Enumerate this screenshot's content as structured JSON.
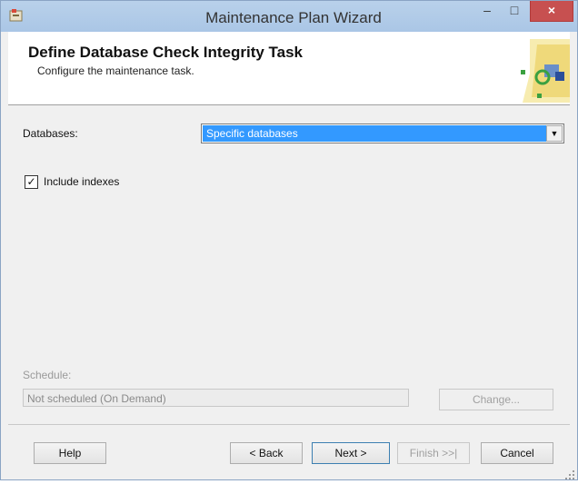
{
  "window": {
    "title": "Maintenance Plan Wizard",
    "minimize": "–",
    "maximize": "□",
    "close": "×"
  },
  "header": {
    "title": "Define Database Check Integrity Task",
    "subtitle": "Configure the maintenance task."
  },
  "form": {
    "databases_label": "Databases:",
    "databases_value": "Specific databases",
    "include_indexes_label": "Include indexes",
    "include_indexes_checked": true,
    "check_mark": "✓",
    "dropdown_arrow": "▼"
  },
  "schedule": {
    "label": "Schedule:",
    "value": "Not scheduled (On Demand)",
    "change_button": "Change..."
  },
  "footer": {
    "help": "Help",
    "back": "< Back",
    "next": "Next >",
    "finish": "Finish >>|",
    "cancel": "Cancel"
  },
  "colors": {
    "selection": "#3399ff",
    "close_button": "#c75050",
    "title_bar": "#b9d1ea"
  }
}
